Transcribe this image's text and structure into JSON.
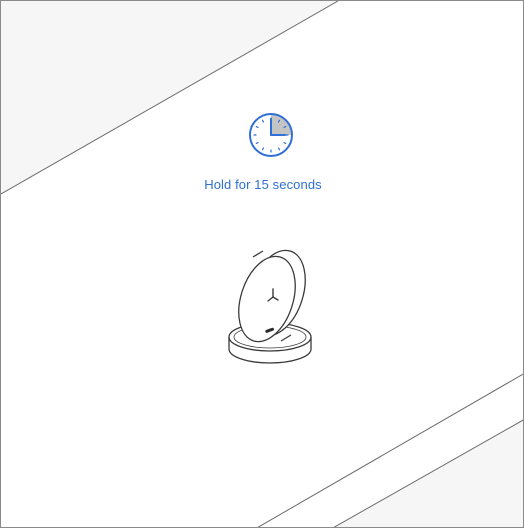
{
  "instruction": {
    "text": "Hold for 15 seconds",
    "color": "#2f6fd6"
  },
  "timer": {
    "icon": "clock-icon",
    "elapsed_fraction": 0.25
  },
  "illustration": {
    "icon": "hub-device-on-charging-base"
  },
  "colors": {
    "accent": "#2f6fd6",
    "shaded_band": "#f6f6f6",
    "line": "#4a4a4a"
  }
}
